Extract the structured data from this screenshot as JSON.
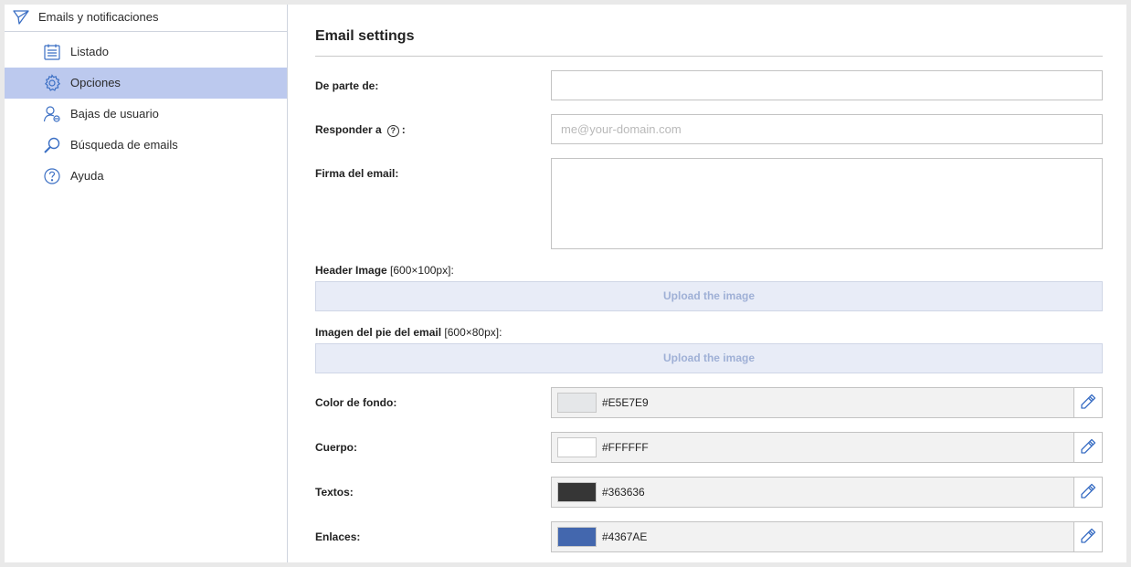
{
  "sidebar": {
    "section_title": "Emails y notificaciones",
    "items": [
      {
        "label": "Listado",
        "icon": "list-calendar-icon"
      },
      {
        "label": "Opciones",
        "icon": "gear-icon",
        "active": true
      },
      {
        "label": "Bajas de usuario",
        "icon": "user-remove-icon"
      },
      {
        "label": "Búsqueda de emails",
        "icon": "search-icon"
      },
      {
        "label": "Ayuda",
        "icon": "help-icon"
      }
    ]
  },
  "main": {
    "title": "Email settings",
    "from_label": "De parte de:",
    "from_value": "",
    "reply_to_label": "Responder a",
    "reply_to_colon": ":",
    "reply_to_placeholder": "me@your-domain.com",
    "signature_label": "Firma del email:",
    "signature_value": "",
    "header_image_label": "Header Image",
    "header_image_size": "[600×100px]:",
    "header_upload_label": "Upload the image",
    "footer_image_label": "Imagen del pie del email",
    "footer_image_size": "[600×80px]:",
    "footer_upload_label": "Upload the image",
    "colors": [
      {
        "label": "Color de fondo:",
        "hex": "#E5E7E9"
      },
      {
        "label": "Cuerpo:",
        "hex": "#FFFFFF"
      },
      {
        "label": "Textos:",
        "hex": "#363636"
      },
      {
        "label": "Enlaces:",
        "hex": "#4367AE"
      }
    ]
  },
  "theme": {
    "active_item_bg": "#BCC9EE",
    "icon_blue": "#3B6FC4",
    "upload_bg": "#E8ECF7"
  }
}
